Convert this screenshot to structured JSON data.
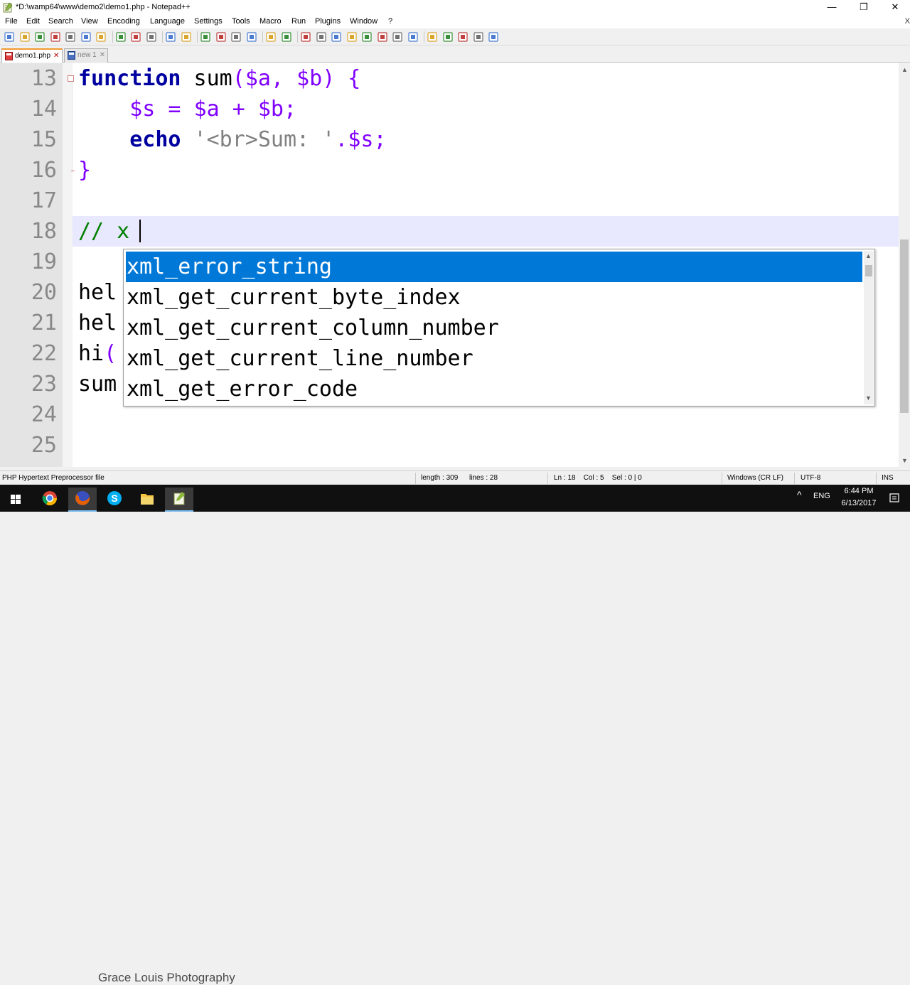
{
  "window": {
    "title": "*D:\\wamp64\\www\\demo2\\demo1.php - Notepad++",
    "minimize_glyph": "—",
    "maximize_glyph": "❐",
    "close_glyph": "✕"
  },
  "menu": {
    "items": [
      "File",
      "Edit",
      "Search",
      "View",
      "Encoding",
      "Language",
      "Settings",
      "Tools",
      "Macro",
      "Run",
      "Plugins",
      "Window",
      "?"
    ],
    "close_doc": "X"
  },
  "toolbar": {
    "icons": [
      "new-file-icon",
      "open-file-icon",
      "save-icon",
      "save-all-icon",
      "close-icon",
      "close-all-icon",
      "print-icon",
      "cut-icon",
      "copy-icon",
      "paste-icon",
      "undo-icon",
      "redo-icon",
      "find-icon",
      "replace-icon",
      "zoom-in-icon",
      "zoom-out-icon",
      "sync-vertical-icon",
      "sync-horizontal-icon",
      "word-wrap-icon",
      "show-all-chars-icon",
      "indent-guide-icon",
      "define-language-icon",
      "document-map-icon",
      "function-list-icon",
      "folder-as-workspace-icon",
      "monitoring-icon",
      "record-macro-icon",
      "stop-macro-icon",
      "play-macro-icon",
      "run-macro-multiple-icon",
      "save-macro-icon"
    ]
  },
  "tabs": [
    {
      "label": "demo1.php",
      "close": "✕",
      "active": true
    },
    {
      "label": "new 1",
      "close": "✕",
      "active": false
    }
  ],
  "editor": {
    "line_numbers": [
      "13",
      "14",
      "15",
      "16",
      "17",
      "18",
      "19",
      "20",
      "21",
      "22",
      "23",
      "24",
      "25"
    ],
    "lines": {
      "l13": {
        "kw": "function",
        "name": " sum",
        "p1": "(",
        "v1": "$a",
        "p2": ", ",
        "v2": "$b",
        "p3": ")",
        "p4": " {"
      },
      "l14": {
        "indent": "    ",
        "v1": "$s",
        "o1": " = ",
        "v2": "$a",
        "o2": " + ",
        "v3": "$b",
        "o3": ";"
      },
      "l15": {
        "indent": "    ",
        "kw": "echo",
        "str": " '<br>Sum: '",
        "o1": ".",
        "v1": "$s",
        "o2": ";"
      },
      "l16": {
        "brace": "}"
      },
      "l18": {
        "comment": "// x"
      },
      "l20": {
        "text": "hel"
      },
      "l21": {
        "text": "hel"
      },
      "l22": {
        "text": "hi",
        "paren": "("
      },
      "l23": {
        "text": "sum"
      }
    },
    "autocomplete": [
      "xml_error_string",
      "xml_get_current_byte_index",
      "xml_get_current_column_number",
      "xml_get_current_line_number",
      "xml_get_error_code"
    ],
    "scroll_up": "▲",
    "scroll_down": "▼"
  },
  "status": {
    "file_type": "PHP Hypertext Preprocessor file",
    "length": "length : 309",
    "lines": "lines : 28",
    "position": "Ln : 18    Col : 5    Sel : 0 | 0",
    "eol": "Windows (CR LF)",
    "encoding": "UTF-8",
    "mode": "INS"
  },
  "taskbar": {
    "watermark": "Grace Louis Photography",
    "tray_arrow": "^",
    "language": "ENG",
    "time": "6:44 PM",
    "date": "6/13/2017",
    "icons": [
      "windows-start-icon",
      "chrome-icon",
      "firefox-icon",
      "skype-icon",
      "file-explorer-icon",
      "notepadpp-icon"
    ]
  },
  "colors": {
    "keyword": "#0000a0",
    "variable": "#8000ff",
    "string": "#808080",
    "comment": "#008000",
    "selection": "#0078d7",
    "current_line": "#e8e8ff"
  }
}
